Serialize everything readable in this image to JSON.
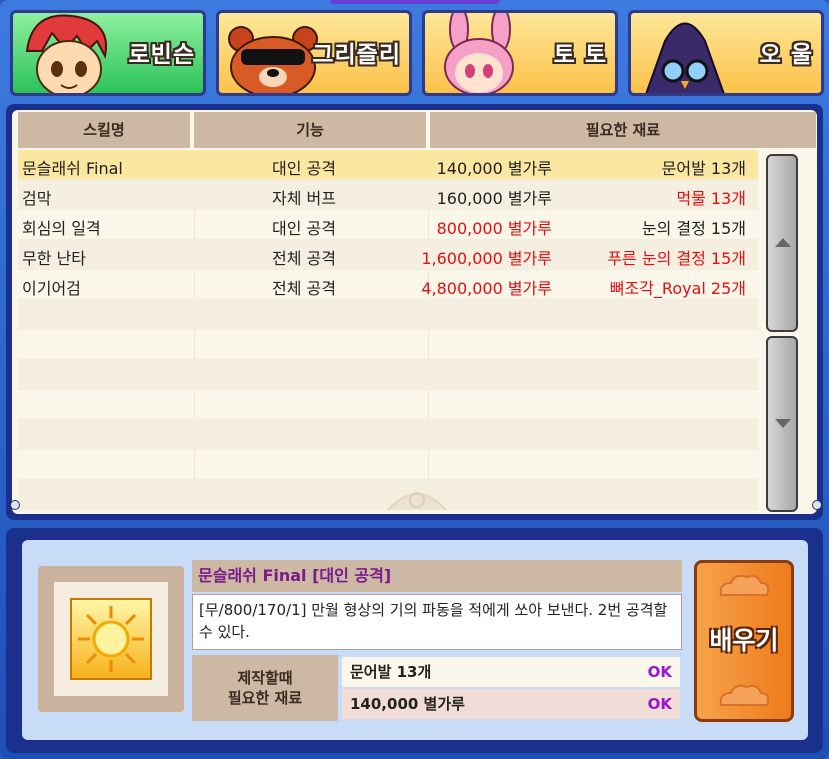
{
  "tabs": [
    {
      "label": "로빈슨",
      "active": true
    },
    {
      "label": "그리즐리",
      "active": false
    },
    {
      "label": "토 토",
      "active": false
    },
    {
      "label": "오 울",
      "active": false
    }
  ],
  "table": {
    "headers": [
      "스킬명",
      "기능",
      "필요한 재료"
    ],
    "rows": [
      {
        "name": "문슬래쉬 Final",
        "func": "대인 공격",
        "cost": "140,000 별가루",
        "material": "문어발 13개",
        "cost_red": false,
        "mat_red": false,
        "selected": true
      },
      {
        "name": "검막",
        "func": "자체 버프",
        "cost": "160,000 별가루",
        "material": "먹물 13개",
        "cost_red": false,
        "mat_red": true,
        "selected": false
      },
      {
        "name": "회심의 일격",
        "func": "대인 공격",
        "cost": "800,000 별가루",
        "material": "눈의 결정 15개",
        "cost_red": true,
        "mat_red": false,
        "selected": false
      },
      {
        "name": "무한 난타",
        "func": "전체 공격",
        "cost": "1,600,000 별가루",
        "material": "푸른 눈의 결정 15개",
        "cost_red": true,
        "mat_red": true,
        "selected": false
      },
      {
        "name": "이기어검",
        "func": "전체 공격",
        "cost": "4,800,000 별가루",
        "material": "뼈조각_Royal 25개",
        "cost_red": true,
        "mat_red": true,
        "selected": false
      }
    ]
  },
  "detail": {
    "title": "문슬래쉬 Final [대인 공격]",
    "description": "[무/800/170/1] 만월 형상의 기의 파동을 적에게 쏘아 보낸다. 2번 공격할 수 있다.",
    "materials_label_line1": "제작할때",
    "materials_label_line2": "필요한 재료",
    "materials": [
      {
        "item": "문어발 13개",
        "status": "OK"
      },
      {
        "item": "140,000 별가루",
        "status": "OK"
      }
    ],
    "learn_label": "배우기"
  },
  "colors": {
    "accent_ok": "#9a14c8",
    "warn_red": "#e01010",
    "frame_blue": "#1b2f8c"
  }
}
